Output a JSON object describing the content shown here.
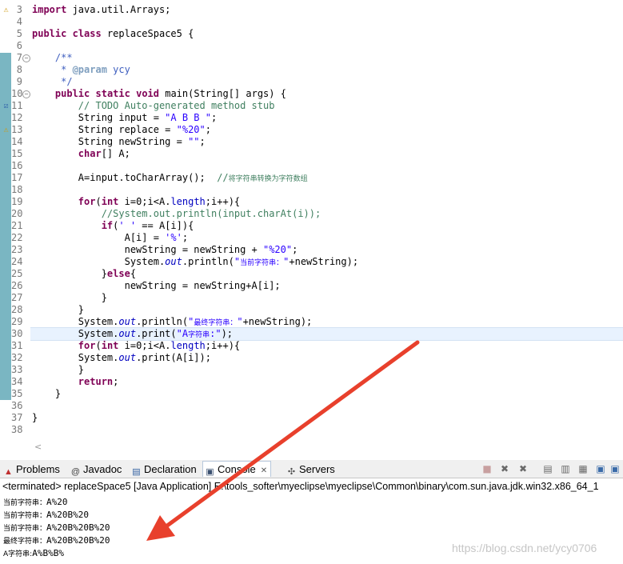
{
  "editor": {
    "lines": [
      {
        "n": "3",
        "marker": "warn"
      },
      {
        "n": "4"
      },
      {
        "n": "5"
      },
      {
        "n": "6"
      },
      {
        "n": "7",
        "fold": true
      },
      {
        "n": "8"
      },
      {
        "n": "9"
      },
      {
        "n": "10",
        "fold": true
      },
      {
        "n": "11",
        "marker": "task"
      },
      {
        "n": "12"
      },
      {
        "n": "13",
        "marker": "warn"
      },
      {
        "n": "14"
      },
      {
        "n": "15"
      },
      {
        "n": "16"
      },
      {
        "n": "17"
      },
      {
        "n": "18"
      },
      {
        "n": "19"
      },
      {
        "n": "20"
      },
      {
        "n": "21"
      },
      {
        "n": "22"
      },
      {
        "n": "23"
      },
      {
        "n": "24"
      },
      {
        "n": "25"
      },
      {
        "n": "26"
      },
      {
        "n": "27"
      },
      {
        "n": "28"
      },
      {
        "n": "29"
      },
      {
        "n": "30"
      },
      {
        "n": "31"
      },
      {
        "n": "32"
      },
      {
        "n": "33"
      },
      {
        "n": "34"
      },
      {
        "n": "35"
      },
      {
        "n": "36"
      },
      {
        "n": "37"
      },
      {
        "n": "38"
      }
    ],
    "code": {
      "l3": [
        {
          "t": "import",
          "c": "kw"
        },
        {
          "t": " java.util.Arrays;"
        }
      ],
      "l5": [
        {
          "t": "public",
          "c": "kw"
        },
        {
          "t": " "
        },
        {
          "t": "class",
          "c": "kw"
        },
        {
          "t": " replaceSpace5 {"
        }
      ],
      "l7": [
        {
          "t": "    /**",
          "c": "jdoc"
        }
      ],
      "l8": [
        {
          "t": "     * ",
          "c": "jdoc"
        },
        {
          "t": "@param",
          "c": "jtag"
        },
        {
          "t": " ycy",
          "c": "jdoc"
        }
      ],
      "l9": [
        {
          "t": "     */",
          "c": "jdoc"
        }
      ],
      "l10": [
        {
          "t": "    "
        },
        {
          "t": "public",
          "c": "kw"
        },
        {
          "t": " "
        },
        {
          "t": "static",
          "c": "kw"
        },
        {
          "t": " "
        },
        {
          "t": "void",
          "c": "kw"
        },
        {
          "t": " main(String[] args) {"
        }
      ],
      "l11": [
        {
          "t": "        // TODO Auto-generated method stub",
          "c": "cmt"
        }
      ],
      "l12": [
        {
          "t": "        String input = "
        },
        {
          "t": "\"A B B \"",
          "c": "str"
        },
        {
          "t": ";"
        }
      ],
      "l13": [
        {
          "t": "        String replace = "
        },
        {
          "t": "\"%20\"",
          "c": "str"
        },
        {
          "t": ";"
        }
      ],
      "l14": [
        {
          "t": "        String newString = "
        },
        {
          "t": "\"\"",
          "c": "str"
        },
        {
          "t": ";"
        }
      ],
      "l15": [
        {
          "t": "        "
        },
        {
          "t": "char",
          "c": "kw"
        },
        {
          "t": "[] A;"
        }
      ],
      "l17": [
        {
          "t": "        A=input.toCharArray();  "
        },
        {
          "t": "//",
          "c": "cmt"
        },
        {
          "t": "将字符串转换为字符数组",
          "c": "cmt cjk"
        }
      ],
      "l19": [
        {
          "t": "        "
        },
        {
          "t": "for",
          "c": "kw"
        },
        {
          "t": "("
        },
        {
          "t": "int",
          "c": "kw"
        },
        {
          "t": " i=0;i<A."
        },
        {
          "t": "length",
          "c": "fld"
        },
        {
          "t": ";i++){"
        }
      ],
      "l20": [
        {
          "t": "            //System.out.println(input.charAt(i));",
          "c": "cmt"
        }
      ],
      "l21": [
        {
          "t": "            "
        },
        {
          "t": "if",
          "c": "kw"
        },
        {
          "t": "("
        },
        {
          "t": "' '",
          "c": "str"
        },
        {
          "t": " == A[i]){"
        }
      ],
      "l22": [
        {
          "t": "                A[i] = "
        },
        {
          "t": "'%'",
          "c": "str"
        },
        {
          "t": ";"
        }
      ],
      "l23": [
        {
          "t": "                newString = newString + "
        },
        {
          "t": "\"%20\"",
          "c": "str"
        },
        {
          "t": ";"
        }
      ],
      "l24": [
        {
          "t": "                System."
        },
        {
          "t": "out",
          "c": "ital"
        },
        {
          "t": ".println("
        },
        {
          "t": "\"",
          "c": "str"
        },
        {
          "t": "当前字符串：",
          "c": "str cjk"
        },
        {
          "t": "\"",
          "c": "str"
        },
        {
          "t": "+newString);"
        }
      ],
      "l25": [
        {
          "t": "            }"
        },
        {
          "t": "else",
          "c": "kw"
        },
        {
          "t": "{"
        }
      ],
      "l26": [
        {
          "t": "                newString = newString+A[i];"
        }
      ],
      "l27": [
        {
          "t": "            }"
        }
      ],
      "l28": [
        {
          "t": "        }"
        }
      ],
      "l29": [
        {
          "t": "        System."
        },
        {
          "t": "out",
          "c": "ital"
        },
        {
          "t": ".println("
        },
        {
          "t": "\"",
          "c": "str"
        },
        {
          "t": "最终字符串：",
          "c": "str cjk"
        },
        {
          "t": "\"",
          "c": "str"
        },
        {
          "t": "+newString);"
        }
      ],
      "l30": [
        {
          "t": "        System."
        },
        {
          "t": "out",
          "c": "ital"
        },
        {
          "t": ".print("
        },
        {
          "t": "\"A",
          "c": "str"
        },
        {
          "t": "字符串",
          "c": "str cjk"
        },
        {
          "t": ":\"",
          "c": "str"
        },
        {
          "t": ");"
        }
      ],
      "l31": [
        {
          "t": "        "
        },
        {
          "t": "for",
          "c": "kw"
        },
        {
          "t": "("
        },
        {
          "t": "int",
          "c": "kw"
        },
        {
          "t": " i=0;i<A."
        },
        {
          "t": "length",
          "c": "fld"
        },
        {
          "t": ";i++){"
        }
      ],
      "l32": [
        {
          "t": "        System."
        },
        {
          "t": "out",
          "c": "ital"
        },
        {
          "t": ".print(A[i]);"
        }
      ],
      "l33": [
        {
          "t": "        }"
        }
      ],
      "l34": [
        {
          "t": "        "
        },
        {
          "t": "return",
          "c": "kw"
        },
        {
          "t": ";"
        }
      ],
      "l35": [
        {
          "t": "    }"
        }
      ],
      "l37": [
        {
          "t": "}"
        }
      ]
    },
    "hscroll_arrow": "<"
  },
  "views": {
    "tabs": [
      {
        "label": "Problems",
        "icon": "problems-icon",
        "glyph": "▲",
        "color": "#c03030"
      },
      {
        "label": "Javadoc",
        "icon": "javadoc-icon",
        "glyph": "@",
        "color": "#404040"
      },
      {
        "label": "Declaration",
        "icon": "declaration-icon",
        "glyph": "▤",
        "color": "#3060a0"
      },
      {
        "label": "Console",
        "icon": "console-icon",
        "glyph": "▣",
        "color": "#3a5070",
        "close": "✕"
      },
      {
        "label": "Servers",
        "icon": "servers-icon",
        "glyph": "✣",
        "color": "#505050"
      }
    ],
    "toolbar": [
      {
        "name": "terminate-icon",
        "glyph": "■",
        "color": "#c8a0a0"
      },
      {
        "name": "remove-launch-icon",
        "glyph": "✖",
        "color": "#6a6a6a"
      },
      {
        "name": "remove-all-terminated-icon",
        "glyph": "✖",
        "color": "#6a6a6a"
      },
      {
        "name": "clear-console-icon",
        "glyph": "▤",
        "color": "#6a6a6a"
      },
      {
        "name": "scroll-lock-icon",
        "glyph": "▥",
        "color": "#6a6a6a"
      },
      {
        "name": "pin-console-icon",
        "glyph": "▦",
        "color": "#6a6a6a"
      },
      {
        "name": "display-console-icon",
        "glyph": "▣",
        "color": "#3a6aa8"
      },
      {
        "name": "open-console-icon",
        "glyph": "▣",
        "color": "#3a6aa8"
      }
    ],
    "status": "<terminated> replaceSpace5 [Java Application] E:\\tools_softer\\myeclipse\\myeclipse\\Common\\binary\\com.sun.java.jdk.win32.x86_64_1",
    "output": [
      [
        {
          "t": "当前字符串：",
          "c": "cjk"
        },
        {
          "t": "A%20"
        }
      ],
      [
        {
          "t": "当前字符串：",
          "c": "cjk"
        },
        {
          "t": "A%20B%20"
        }
      ],
      [
        {
          "t": "当前字符串：",
          "c": "cjk"
        },
        {
          "t": "A%20B%20B%20"
        }
      ],
      [
        {
          "t": "最终字符串：",
          "c": "cjk"
        },
        {
          "t": "A%20B%20B%20"
        }
      ],
      [
        {
          "t": "A字符串:",
          "c": "cjk"
        },
        {
          "t": "A%B%B%"
        }
      ]
    ],
    "watermark": "https://blog.csdn.net/ycy0706"
  },
  "colors": {
    "keyword": "#7f0055",
    "string": "#2a00ff",
    "comment": "#3f7f5f",
    "javadoc": "#3f5fbf",
    "current_line": "#e8f2fe",
    "change_bar": "#7ab6c2",
    "arrow": "#e8402c"
  }
}
